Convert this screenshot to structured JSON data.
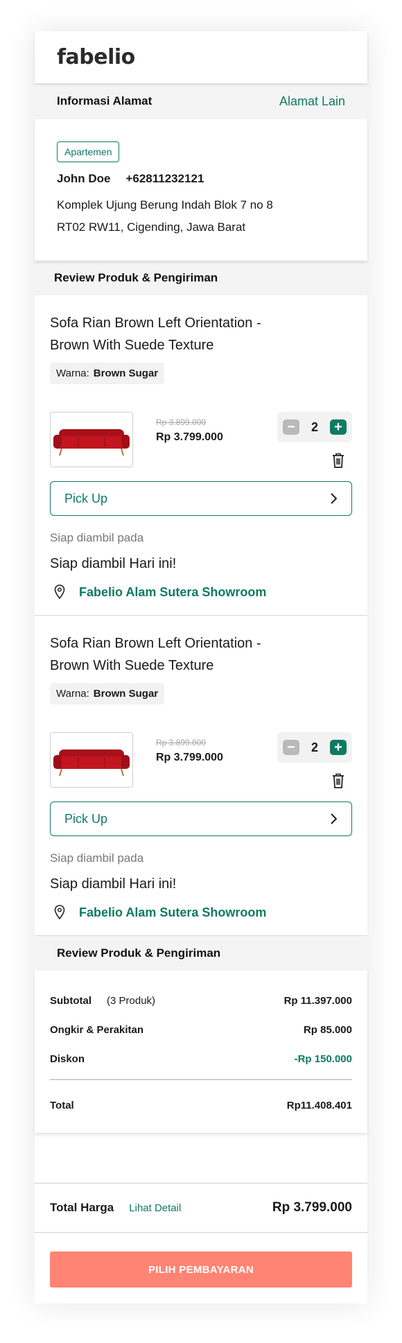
{
  "app": {
    "logo": "fabelio"
  },
  "address_section": {
    "title": "Informasi Alamat",
    "other_link": "Alamat Lain"
  },
  "address": {
    "badge": "Apartemen",
    "name": "John Doe",
    "phone": "+62811232121",
    "line1": "Komplek Ujung Berung Indah Blok 7 no 8",
    "line2": "RT02 RW11, Cigending, Jawa Barat"
  },
  "review_title": "Review Produk & Pengiriman",
  "products": [
    {
      "name_line1": "Sofa Rian Brown Left Orientation -",
      "name_line2": "Brown With Suede Texture",
      "variant_label": "Warna:",
      "variant_value": "Brown Sugar",
      "old_price": "Rp 3.899.000",
      "price": "Rp 3.799.000",
      "qty": "2",
      "shipping_option": "Pick Up",
      "ready_label": "Siap diambil pada",
      "ready_value": "Siap diambil Hari ini!",
      "store": "Fabelio Alam Sutera Showroom"
    },
    {
      "name_line1": "Sofa Rian Brown Left Orientation -",
      "name_line2": "Brown With Suede Texture",
      "variant_label": "Warna:",
      "variant_value": "Brown Sugar",
      "old_price": "Rp 3.899.000",
      "price": "Rp 3.799.000",
      "qty": "2",
      "shipping_option": "Pick Up",
      "ready_label": "Siap diambil pada",
      "ready_value": "Siap diambil Hari ini!",
      "store": "Fabelio Alam Sutera Showroom"
    }
  ],
  "summary": {
    "title": "Review Produk & Pengiriman",
    "subtotal_label": "Subtotal",
    "subtotal_count": "(3 Produk)",
    "subtotal_value": "Rp 11.397.000",
    "shipping_label": "Ongkir & Perakitan",
    "shipping_value": "Rp 85.000",
    "discount_label": "Diskon",
    "discount_value": "-Rp 150.000",
    "total_label": "Total",
    "total_value": "Rp11.408.401"
  },
  "footer": {
    "total_label": "Total Harga",
    "detail_link": "Lihat Detail",
    "total_value": "Rp 3.799.000",
    "pay_button": "PILIH PEMBAYARAN"
  },
  "colors": {
    "accent": "#0f7a61",
    "pay_button": "#ff8474",
    "sofa": "#b5141c"
  },
  "icons": [
    "minus-icon",
    "plus-icon",
    "trash-icon",
    "chevron-right-icon",
    "location-pin-icon"
  ]
}
